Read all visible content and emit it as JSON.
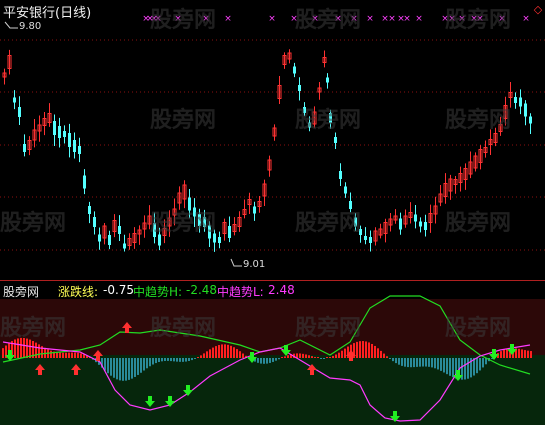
{
  "main_panel": {
    "title": "平安银行(日线)",
    "high_marker": "9.80",
    "low_marker": "9.01",
    "signal_glyph": "×",
    "diamond_glyph": "◇"
  },
  "indicator_panel": {
    "name": "股旁网",
    "zdx_label": "涨跌线:",
    "zdx_value": "-0.75",
    "trend_h_label": "中趋势H:",
    "trend_h_value": "-2.48",
    "trend_l_label": "中趋势L:",
    "trend_l_value": "2.48"
  },
  "watermark": "股旁网",
  "colors": {
    "up_candle": "#ff3232",
    "down_candle": "#54ffff",
    "signal": "#ff40ff",
    "dotted_grid": "#8b1010",
    "trend_h": "#22dd22",
    "trend_l": "#ff3bff",
    "zdx_text": "#ffff55",
    "bar_red": "#ff2020",
    "bar_teal": "#2a8a9a",
    "up_arrow": "#ff3030",
    "down_arrow": "#22ee22"
  },
  "chart_data": {
    "type": "candlestick",
    "title": "平安银行(日线)",
    "price_markers": {
      "high": 9.8,
      "low": 9.01
    },
    "indicator_readout": {
      "涨跌线": -0.75,
      "中趋势H": -2.48,
      "中趋势L": 2.48
    }
  }
}
